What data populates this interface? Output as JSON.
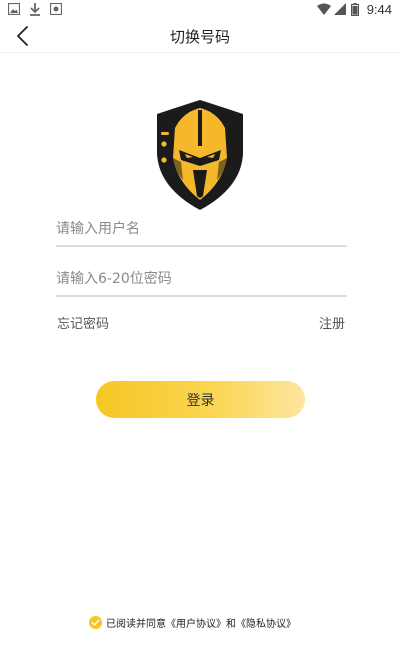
{
  "status_bar": {
    "time": "9:44",
    "left_icons": [
      "image-icon",
      "download-icon",
      "photo-icon"
    ],
    "right_icons": [
      "wifi-icon",
      "signal-icon",
      "battery-icon"
    ]
  },
  "header": {
    "title": "切换号码",
    "back_icon": "chevron-left-icon"
  },
  "logo": {
    "icon": "knight-helmet-logo",
    "colors": {
      "shield": "#1b1b1b",
      "helmet": "#f5b82b"
    }
  },
  "form": {
    "username_placeholder": "请输入用户名",
    "username_value": "",
    "password_placeholder": "请输入6-20位密码",
    "password_value": "",
    "forgot_label": "忘记密码",
    "register_label": "注册",
    "login_label": "登录"
  },
  "agreement": {
    "checked": true,
    "prefix": "已阅读并同意",
    "user_agreement": "《用户协议》",
    "and": "和",
    "privacy_agreement": "《隐私协议》"
  },
  "colors": {
    "accent": "#f6c623",
    "divider": "#dcdcdc",
    "placeholder": "#8a8a8a"
  }
}
